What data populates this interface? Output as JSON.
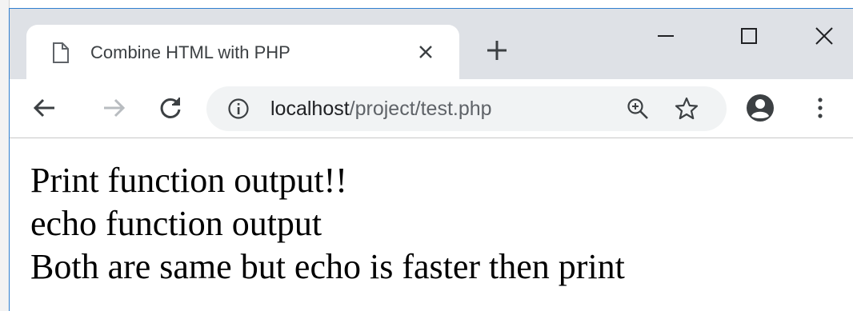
{
  "browser": {
    "tab": {
      "title": "Combine HTML with PHP",
      "icon": "page-icon"
    },
    "address_bar": {
      "host": "localhost",
      "path": "/project/test.php"
    },
    "icons": {
      "back": "arrow-left-icon",
      "forward": "arrow-right-icon",
      "reload": "reload-icon",
      "info": "info-icon",
      "zoom": "zoom-in-icon",
      "bookmark": "star-icon",
      "profile": "account-icon",
      "menu": "kebab-menu-icon",
      "new_tab": "plus-icon",
      "minimize": "minimize-icon",
      "maximize": "maximize-icon",
      "close": "close-icon"
    },
    "colors": {
      "tabstrip": "#dee1e6",
      "omnibox": "#f1f3f4",
      "window_border": "#2f7fd0"
    }
  },
  "page": {
    "lines": [
      "Print function output!!",
      "echo function output",
      "Both are same but echo is faster then print"
    ]
  }
}
